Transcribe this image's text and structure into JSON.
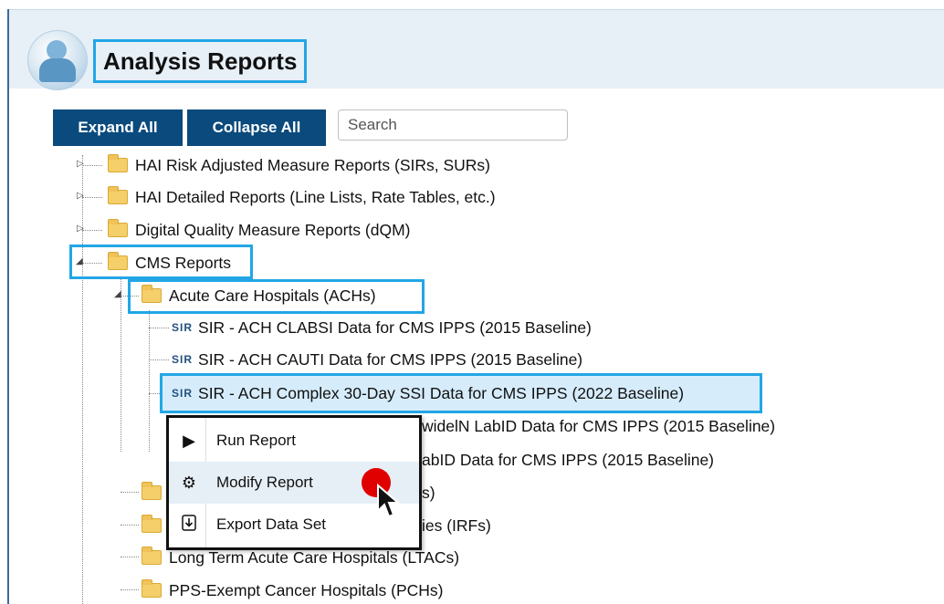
{
  "header": {
    "title": "Analysis Reports"
  },
  "toolbar": {
    "expand_label": "Expand All",
    "collapse_label": "Collapse All",
    "search_placeholder": "Search"
  },
  "tree": {
    "items": [
      {
        "label": "HAI Risk Adjusted Measure Reports (SIRs, SURs)"
      },
      {
        "label": "HAI Detailed Reports (Line Lists, Rate Tables, etc.)"
      },
      {
        "label": "Digital Quality Measure Reports (dQM)"
      },
      {
        "label": "CMS Reports"
      }
    ],
    "ach_label": "Acute Care Hospitals (ACHs)",
    "sir_badge": "SIR",
    "reports": [
      {
        "label": "SIR - ACH CLABSI Data for CMS IPPS (2015 Baseline)"
      },
      {
        "label": "SIR - ACH CAUTI Data for CMS IPPS (2015 Baseline)"
      },
      {
        "label": "SIR - ACH Complex 30-Day SSI Data for CMS IPPS (2022 Baseline)"
      },
      {
        "label_partial": "widelN LabID Data for CMS IPPS (2015 Baseline)"
      },
      {
        "label_partial": "abID Data for CMS IPPS (2015 Baseline)"
      }
    ],
    "hidden_rows": [
      {
        "label_partial": "s)"
      },
      {
        "label_partial": "ies (IRFs)"
      },
      {
        "label": "Long Term Acute Care Hospitals (LTACs)"
      },
      {
        "label": "PPS-Exempt Cancer Hospitals (PCHs)"
      }
    ]
  },
  "context_menu": {
    "items": [
      {
        "label": "Run Report",
        "icon": "play-icon"
      },
      {
        "label": "Modify Report",
        "icon": "gear-icon"
      },
      {
        "label": "Export Data Set",
        "icon": "export-icon"
      }
    ]
  },
  "colors": {
    "highlight": "#22a6e6",
    "button": "#0a4a7c",
    "header_bg": "#e7eff7",
    "marker": "#e00000"
  }
}
